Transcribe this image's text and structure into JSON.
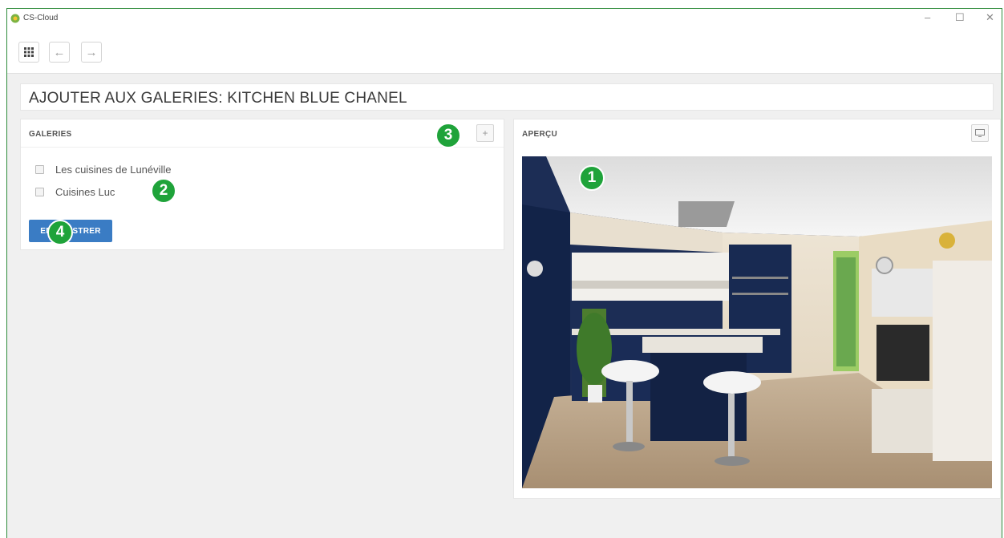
{
  "window": {
    "title": "CS-Cloud",
    "minimize": "–",
    "maximize": "☐",
    "close": "✕"
  },
  "toolbar": {
    "back_glyph": "←",
    "forward_glyph": "→"
  },
  "header": {
    "title": "AJOUTER AUX GALERIES: KITCHEN BLUE CHANEL"
  },
  "galleries_panel": {
    "title": "GALERIES",
    "add_button": "+",
    "items": [
      {
        "label": "Les cuisines de Lunéville",
        "checked": false
      },
      {
        "label": "Cuisines Luc",
        "checked": false
      }
    ],
    "save_button": "ENREGISTRER"
  },
  "preview_panel": {
    "title": "APERÇU",
    "image": "kitchen-render"
  },
  "callouts": [
    "1",
    "2",
    "3",
    "4"
  ],
  "colors": {
    "accent": "#1fa33a",
    "primary_button": "#3a7cc4",
    "window_border": "#2e8b3a",
    "background": "#f0f0f0"
  }
}
